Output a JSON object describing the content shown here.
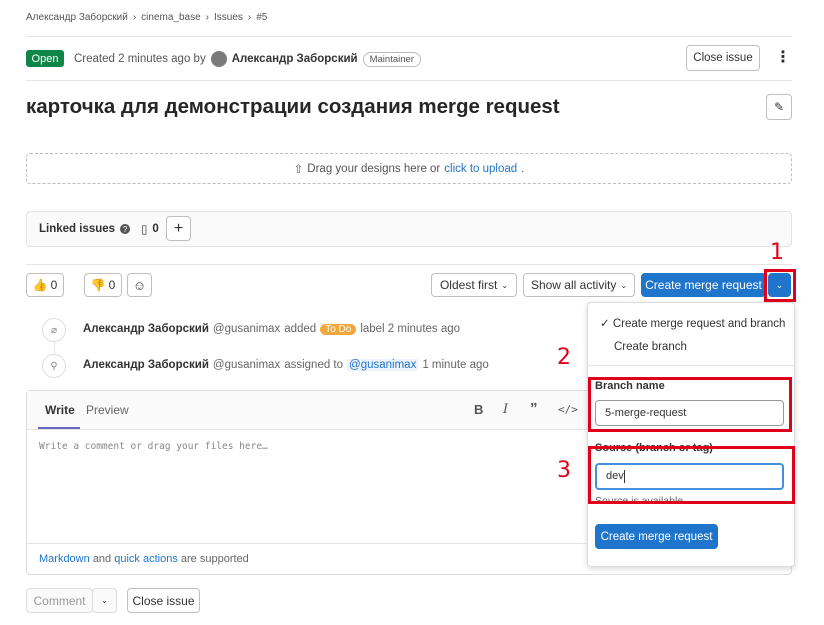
{
  "breadcrumb": {
    "user": "Александр Заборский",
    "project": "cinema_base",
    "issues": "Issues",
    "issue_ref": "#5"
  },
  "header": {
    "status": "Open",
    "created_text": "Created 2 minutes ago by",
    "author": "Александр Заборский",
    "role": "Maintainer",
    "close_issue": "Close issue"
  },
  "issue": {
    "title": "карточка для демонстрации создания merge request"
  },
  "designs": {
    "text": "Drag your designs here or",
    "link": "click to upload",
    "end": "."
  },
  "linked": {
    "label": "Linked issues",
    "count": "0"
  },
  "reactions": {
    "thumbs_up": "0",
    "thumbs_down": "0"
  },
  "sort": {
    "order": "Oldest first",
    "filter": "Show all activity"
  },
  "merge": {
    "create_mr": "Create merge request"
  },
  "activity": [
    {
      "user": "Александр Заборский",
      "handle": "@gusanimax",
      "action": "added",
      "label": "To Do",
      "rest": "label 2 minutes ago"
    },
    {
      "user": "Александр Заборский",
      "handle": "@gusanimax",
      "action": "assigned to",
      "target": "@gusanimax",
      "rest": "1 minute ago"
    }
  ],
  "comment": {
    "tab_write": "Write",
    "tab_preview": "Preview",
    "placeholder": "Write a comment or drag your files here…",
    "markdown": "Markdown",
    "and": "and",
    "quick_actions": "quick actions",
    "supported": "are supported"
  },
  "footer": {
    "comment_btn": "Comment",
    "close_issue": "Close issue"
  },
  "dropdown": {
    "opt1": "Create merge request and branch",
    "opt2": "Create branch",
    "branch_label": "Branch name",
    "branch_value": "5-merge-request",
    "source_label": "Source (branch or tag)",
    "source_value": "dev",
    "source_hint": "Source is available",
    "submit": "Create merge request"
  },
  "annotations": {
    "n1": "1",
    "n2": "2",
    "n3": "3"
  },
  "colors": {
    "accent": "#1f75cb",
    "open": "#108548",
    "annotation": "#e0001b",
    "todo": "#f2a73b"
  }
}
